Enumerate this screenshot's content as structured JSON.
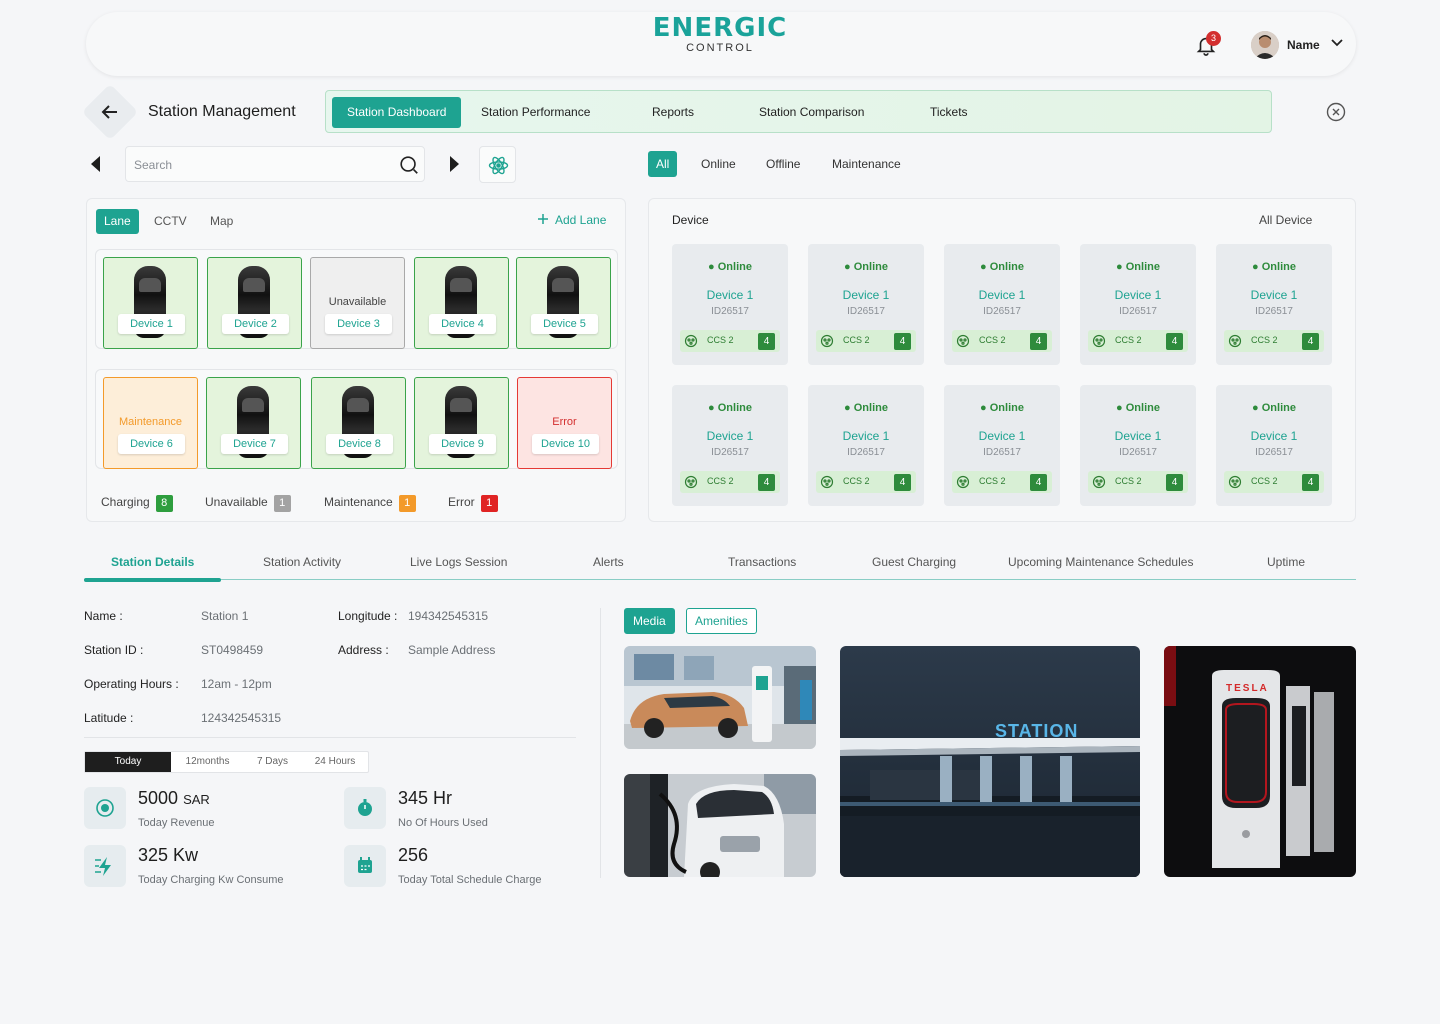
{
  "header": {
    "logo_main": "ENERGIC",
    "logo_sub": "CONTROL",
    "notification_count": "3",
    "user_name": "Name"
  },
  "title_bar": {
    "title": "Station Management",
    "tabs": [
      {
        "label": "Station Dashboard",
        "active": true
      },
      {
        "label": "Station Performance"
      },
      {
        "label": "Reports"
      },
      {
        "label": "Station Comparison"
      },
      {
        "label": "Tickets"
      }
    ]
  },
  "search": {
    "placeholder": "Search",
    "value": ""
  },
  "status_filters": [
    "All",
    "Online",
    "Offline",
    "Maintenance"
  ],
  "lane_panel": {
    "tabs": [
      "Lane",
      "CCTV",
      "Map"
    ],
    "add_lane_label": "Add Lane",
    "lanes": [
      [
        {
          "name": "Device 1",
          "status": "charging",
          "status_text": ""
        },
        {
          "name": "Device 2",
          "status": "charging",
          "status_text": ""
        },
        {
          "name": "Device 3",
          "status": "unavailable",
          "status_text": "Unavailable"
        },
        {
          "name": "Device 4",
          "status": "charging",
          "status_text": ""
        },
        {
          "name": "Device 5",
          "status": "charging",
          "status_text": ""
        }
      ],
      [
        {
          "name": "Device 6",
          "status": "maintenance",
          "status_text": "Maintenance"
        },
        {
          "name": "Device 7",
          "status": "charging",
          "status_text": ""
        },
        {
          "name": "Device 8",
          "status": "charging",
          "status_text": ""
        },
        {
          "name": "Device 9",
          "status": "charging",
          "status_text": ""
        },
        {
          "name": "Device 10",
          "status": "error",
          "status_text": "Error"
        }
      ]
    ],
    "legend": [
      {
        "label": "Charging",
        "count": "8",
        "color": "#2e9e3e"
      },
      {
        "label": "Unavailable",
        "count": "1",
        "color": "#a3a3a3"
      },
      {
        "label": "Maintenance",
        "count": "1",
        "color": "#f39a2a"
      },
      {
        "label": "Error",
        "count": "1",
        "color": "#e02424"
      }
    ]
  },
  "device_panel": {
    "heading": "Device",
    "all_label": "All Device",
    "cards": [
      {
        "status": "● Online",
        "name": "Device 1",
        "id": "ID26517",
        "connector": "CCS 2",
        "count": "4"
      },
      {
        "status": "● Online",
        "name": "Device 1",
        "id": "ID26517",
        "connector": "CCS 2",
        "count": "4"
      },
      {
        "status": "● Online",
        "name": "Device 1",
        "id": "ID26517",
        "connector": "CCS 2",
        "count": "4"
      },
      {
        "status": "● Online",
        "name": "Device 1",
        "id": "ID26517",
        "connector": "CCS 2",
        "count": "4"
      },
      {
        "status": "● Online",
        "name": "Device 1",
        "id": "ID26517",
        "connector": "CCS 2",
        "count": "4"
      },
      {
        "status": "● Online",
        "name": "Device 1",
        "id": "ID26517",
        "connector": "CCS 2",
        "count": "4"
      },
      {
        "status": "● Online",
        "name": "Device 1",
        "id": "ID26517",
        "connector": "CCS 2",
        "count": "4"
      },
      {
        "status": "● Online",
        "name": "Device 1",
        "id": "ID26517",
        "connector": "CCS 2",
        "count": "4"
      },
      {
        "status": "● Online",
        "name": "Device 1",
        "id": "ID26517",
        "connector": "CCS 2",
        "count": "4"
      },
      {
        "status": "● Online",
        "name": "Device 1",
        "id": "ID26517",
        "connector": "CCS 2",
        "count": "4"
      }
    ]
  },
  "bottom_tabs": [
    "Station Details",
    "Station Activity",
    "Live Logs Session",
    "Alerts",
    "Transactions",
    "Guest Charging",
    "Upcoming Maintenance Schedules",
    "Uptime"
  ],
  "station_details": {
    "name_label": "Name :",
    "name_value": "Station 1",
    "id_label": "Station ID :",
    "id_value": "ST0498459",
    "hours_label": "Operating Hours :",
    "hours_value": "12am - 12pm",
    "lat_label": "Latitude :",
    "lat_value": "124342545315",
    "lon_label": "Longitude :",
    "lon_value": "194342545315",
    "addr_label": "Address :",
    "addr_value": "Sample Address"
  },
  "periods": [
    "Today",
    "12months",
    "7 Days",
    "24 Hours"
  ],
  "stats": [
    {
      "value": "5000",
      "unit": "SAR",
      "label": "Today Revenue"
    },
    {
      "value": "345 Hr",
      "unit": "",
      "label": "No Of Hours Used"
    },
    {
      "value": "325 Kw",
      "unit": "",
      "label": "Today Charging Kw Consume"
    },
    {
      "value": "256",
      "unit": "",
      "label": "Today Total Schedule Charge"
    }
  ],
  "media": {
    "tabs": [
      "Media",
      "Amenities"
    ],
    "station_sign": "STATION",
    "tesla_sign": "TESLA"
  },
  "colors": {
    "accent": "#1ea391",
    "online": "#2e8b3c"
  }
}
